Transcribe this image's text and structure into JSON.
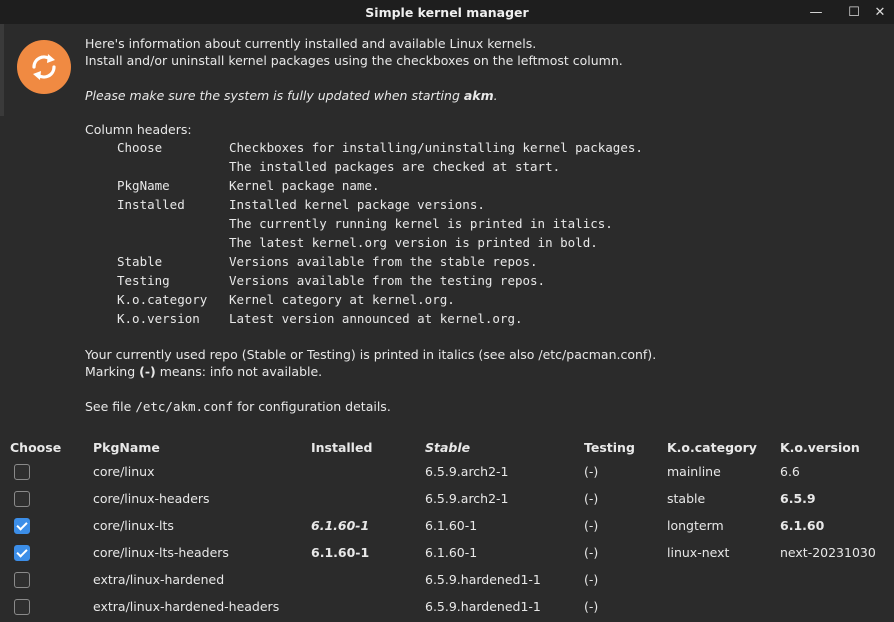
{
  "window": {
    "title": "Simple kernel manager",
    "minimize": "—",
    "maximize": "☐",
    "close": "✕"
  },
  "info": {
    "line1": "Here's information about currently installed and available Linux kernels.",
    "line2": "Install and/or uninstall kernel packages using the checkboxes on the leftmost column.",
    "note_prefix": "Please make sure the system is fully updated when starting ",
    "note_bold": "akm",
    "note_suffix": ".",
    "column_headers_title": "Column headers:",
    "headers": [
      {
        "key": "Choose",
        "desc": [
          "Checkboxes for installing/uninstalling kernel packages.",
          "The installed packages are checked at start."
        ]
      },
      {
        "key": "PkgName",
        "desc": [
          "Kernel package name."
        ]
      },
      {
        "key": "Installed",
        "desc": [
          "Installed kernel package versions.",
          "The currently running kernel is printed in italics.",
          "The latest kernel.org version is printed in bold."
        ]
      },
      {
        "key": "Stable",
        "desc": [
          "Versions available from the stable repos."
        ]
      },
      {
        "key": "Testing",
        "desc": [
          "Versions available from the testing repos."
        ]
      },
      {
        "key": "K.o.category",
        "desc": [
          "Kernel category at kernel.org."
        ]
      },
      {
        "key": "K.o.version",
        "desc": [
          "Latest version announced at kernel.org."
        ]
      }
    ],
    "repo_line": "Your currently used repo (Stable or Testing) is printed in italics (see also /etc/pacman.conf).",
    "marking_prefix": "Marking ",
    "marking_bold": "(-)",
    "marking_suffix": " means: info not available.",
    "seefile_prefix": "See file ",
    "seefile_mono": "/etc/akm.conf",
    "seefile_suffix": " for configuration details."
  },
  "table": {
    "columns": [
      "Choose",
      "PkgName",
      "Installed",
      "Stable",
      "Testing",
      "K.o.category",
      "K.o.version"
    ],
    "rows": [
      {
        "checked": false,
        "pkg": "core/linux",
        "installed": "",
        "installed_style": "",
        "stable": "6.5.9.arch2-1",
        "testing": "(-)",
        "category": "mainline",
        "version": "6.6",
        "version_bold": false
      },
      {
        "checked": false,
        "pkg": "core/linux-headers",
        "installed": "",
        "installed_style": "",
        "stable": "6.5.9.arch2-1",
        "testing": "(-)",
        "category": "stable",
        "version": "6.5.9",
        "version_bold": true
      },
      {
        "checked": true,
        "pkg": "core/linux-lts",
        "installed": "6.1.60-1",
        "installed_style": "bold-italic",
        "stable": "6.1.60-1",
        "testing": "(-)",
        "category": "longterm",
        "version": "6.1.60",
        "version_bold": true
      },
      {
        "checked": true,
        "pkg": "core/linux-lts-headers",
        "installed": "6.1.60-1",
        "installed_style": "bold",
        "stable": "6.1.60-1",
        "testing": "(-)",
        "category": "linux-next",
        "version": "next-20231030",
        "version_bold": false
      },
      {
        "checked": false,
        "pkg": "extra/linux-hardened",
        "installed": "",
        "installed_style": "",
        "stable": "6.5.9.hardened1-1",
        "testing": "(-)",
        "category": "",
        "version": "",
        "version_bold": false
      },
      {
        "checked": false,
        "pkg": "extra/linux-hardened-headers",
        "installed": "",
        "installed_style": "",
        "stable": "6.5.9.hardened1-1",
        "testing": "(-)",
        "category": "",
        "version": "",
        "version_bold": false
      }
    ]
  },
  "colors": {
    "accent": "#3c8ee8",
    "icon": "#f08a42",
    "background": "#2b2b2b",
    "titlebar": "#1e1e1e"
  }
}
